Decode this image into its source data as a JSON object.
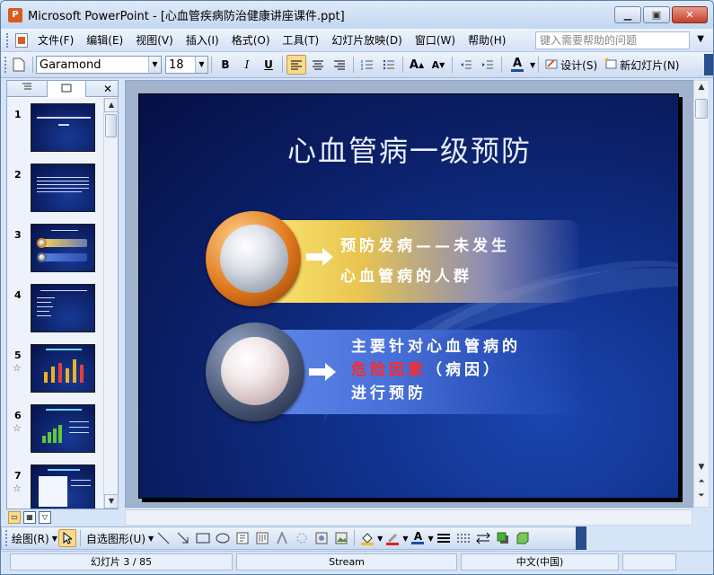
{
  "window": {
    "app_icon_letter": "P",
    "title": "Microsoft PowerPoint - [心血管疾病防治健康讲座课件.ppt]",
    "minimize": "▁",
    "maximize": "▣",
    "close": "✕"
  },
  "menu": {
    "items": [
      "文件(F)",
      "编辑(E)",
      "视图(V)",
      "插入(I)",
      "格式(O)",
      "工具(T)",
      "幻灯片放映(D)",
      "窗口(W)",
      "帮助(H)"
    ],
    "help_placeholder": "键入需要帮助的问题"
  },
  "toolbar": {
    "font_name": "Garamond",
    "font_size": "18",
    "bold": "B",
    "italic": "I",
    "underline": "U",
    "design_label": "设计(S)",
    "new_slide_label": "新幻灯片(N)"
  },
  "outline_panel": {
    "close_glyph": "✕",
    "thumbnails": [
      {
        "number": "1",
        "has_animation": false
      },
      {
        "number": "2",
        "has_animation": false
      },
      {
        "number": "3",
        "has_animation": false
      },
      {
        "number": "4",
        "has_animation": false
      },
      {
        "number": "5",
        "has_animation": true
      },
      {
        "number": "6",
        "has_animation": true
      },
      {
        "number": "7",
        "has_animation": true
      }
    ],
    "animation_glyph": "☆"
  },
  "slide": {
    "title": "心血管病一级预防",
    "item1_line1": "预防发病——未发生",
    "item1_line2": "心血管病的人群",
    "item2_line1": "主要针对心血管病的",
    "item2_red": "危险因素",
    "item2_paren": "（病因）",
    "item2_line3": "进行预防"
  },
  "drawing_toolbar": {
    "draw_label": "绘图(R)",
    "autoshape_label": "自选图形(U)"
  },
  "status": {
    "slide_position": "幻灯片 3 / 85",
    "theme": "Stream",
    "language": "中文(中国)"
  },
  "colors": {
    "slide_bg": "#0b1f66",
    "highlight_red": "#ff2a2a",
    "band1": "#fbe56e",
    "band2": "#5e85e8"
  }
}
